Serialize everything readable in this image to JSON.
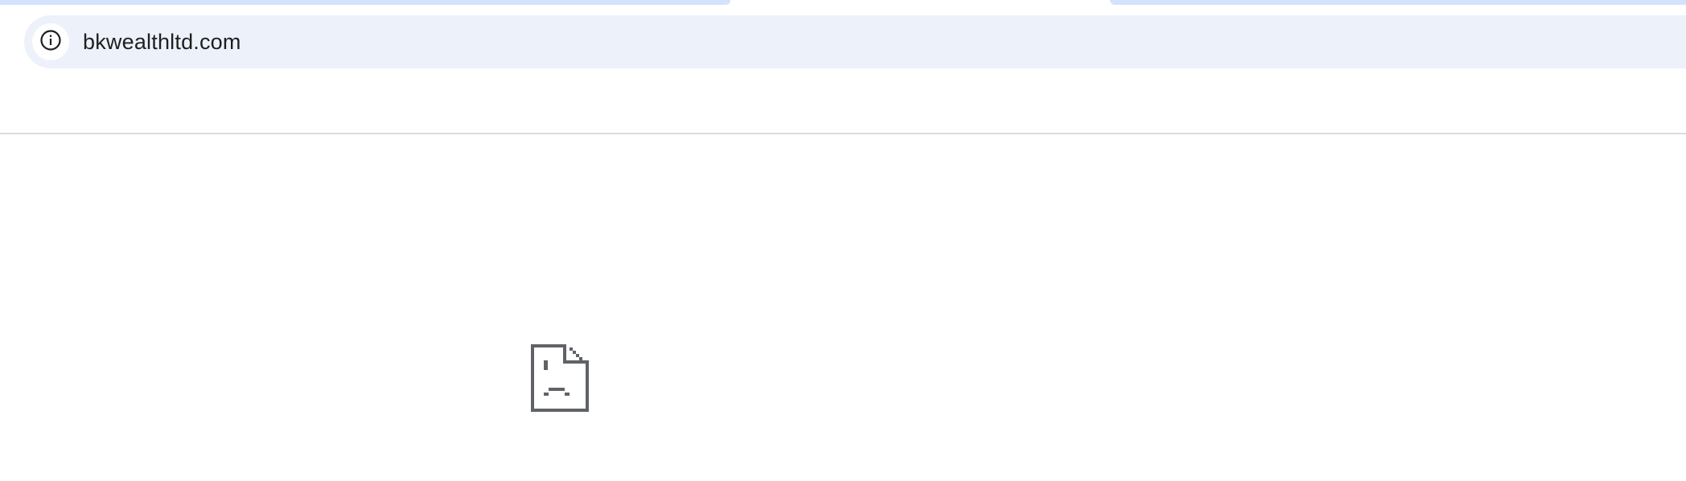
{
  "address_bar": {
    "url": "bkwealthltd.com",
    "site_info_icon": "info-icon"
  },
  "error_page": {
    "icon": "sad-document-icon"
  },
  "colors": {
    "omnibox_background": "#edf1fa",
    "tab_strip": "#d3e3fd",
    "icon_gray": "#5f6368",
    "text": "#1f1f1f"
  }
}
